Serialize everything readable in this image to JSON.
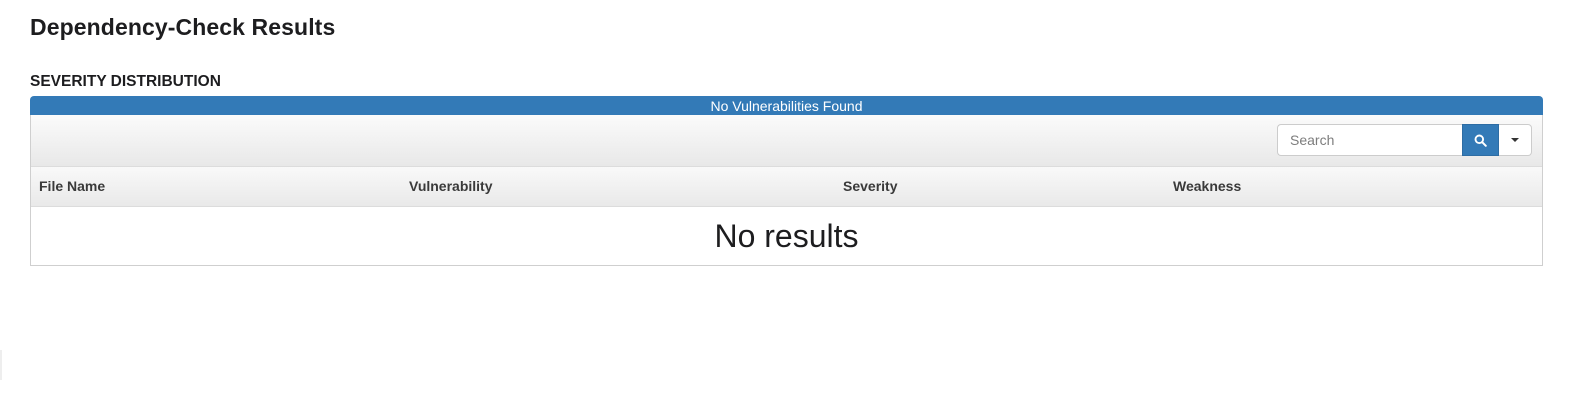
{
  "page": {
    "title": "Dependency-Check Results"
  },
  "severity_section": {
    "title": "SEVERITY DISTRIBUTION",
    "bar_label": "No Vulnerabilities Found",
    "bar_color": "#337ab7"
  },
  "toolbar": {
    "search_placeholder": "Search",
    "search_icon": "search-icon",
    "dropdown_icon": "caret-down-icon",
    "accent_color": "#337ab7"
  },
  "table": {
    "columns": [
      "File Name",
      "Vulnerability",
      "Severity",
      "Weakness"
    ],
    "rows": [],
    "empty_message": "No results"
  }
}
